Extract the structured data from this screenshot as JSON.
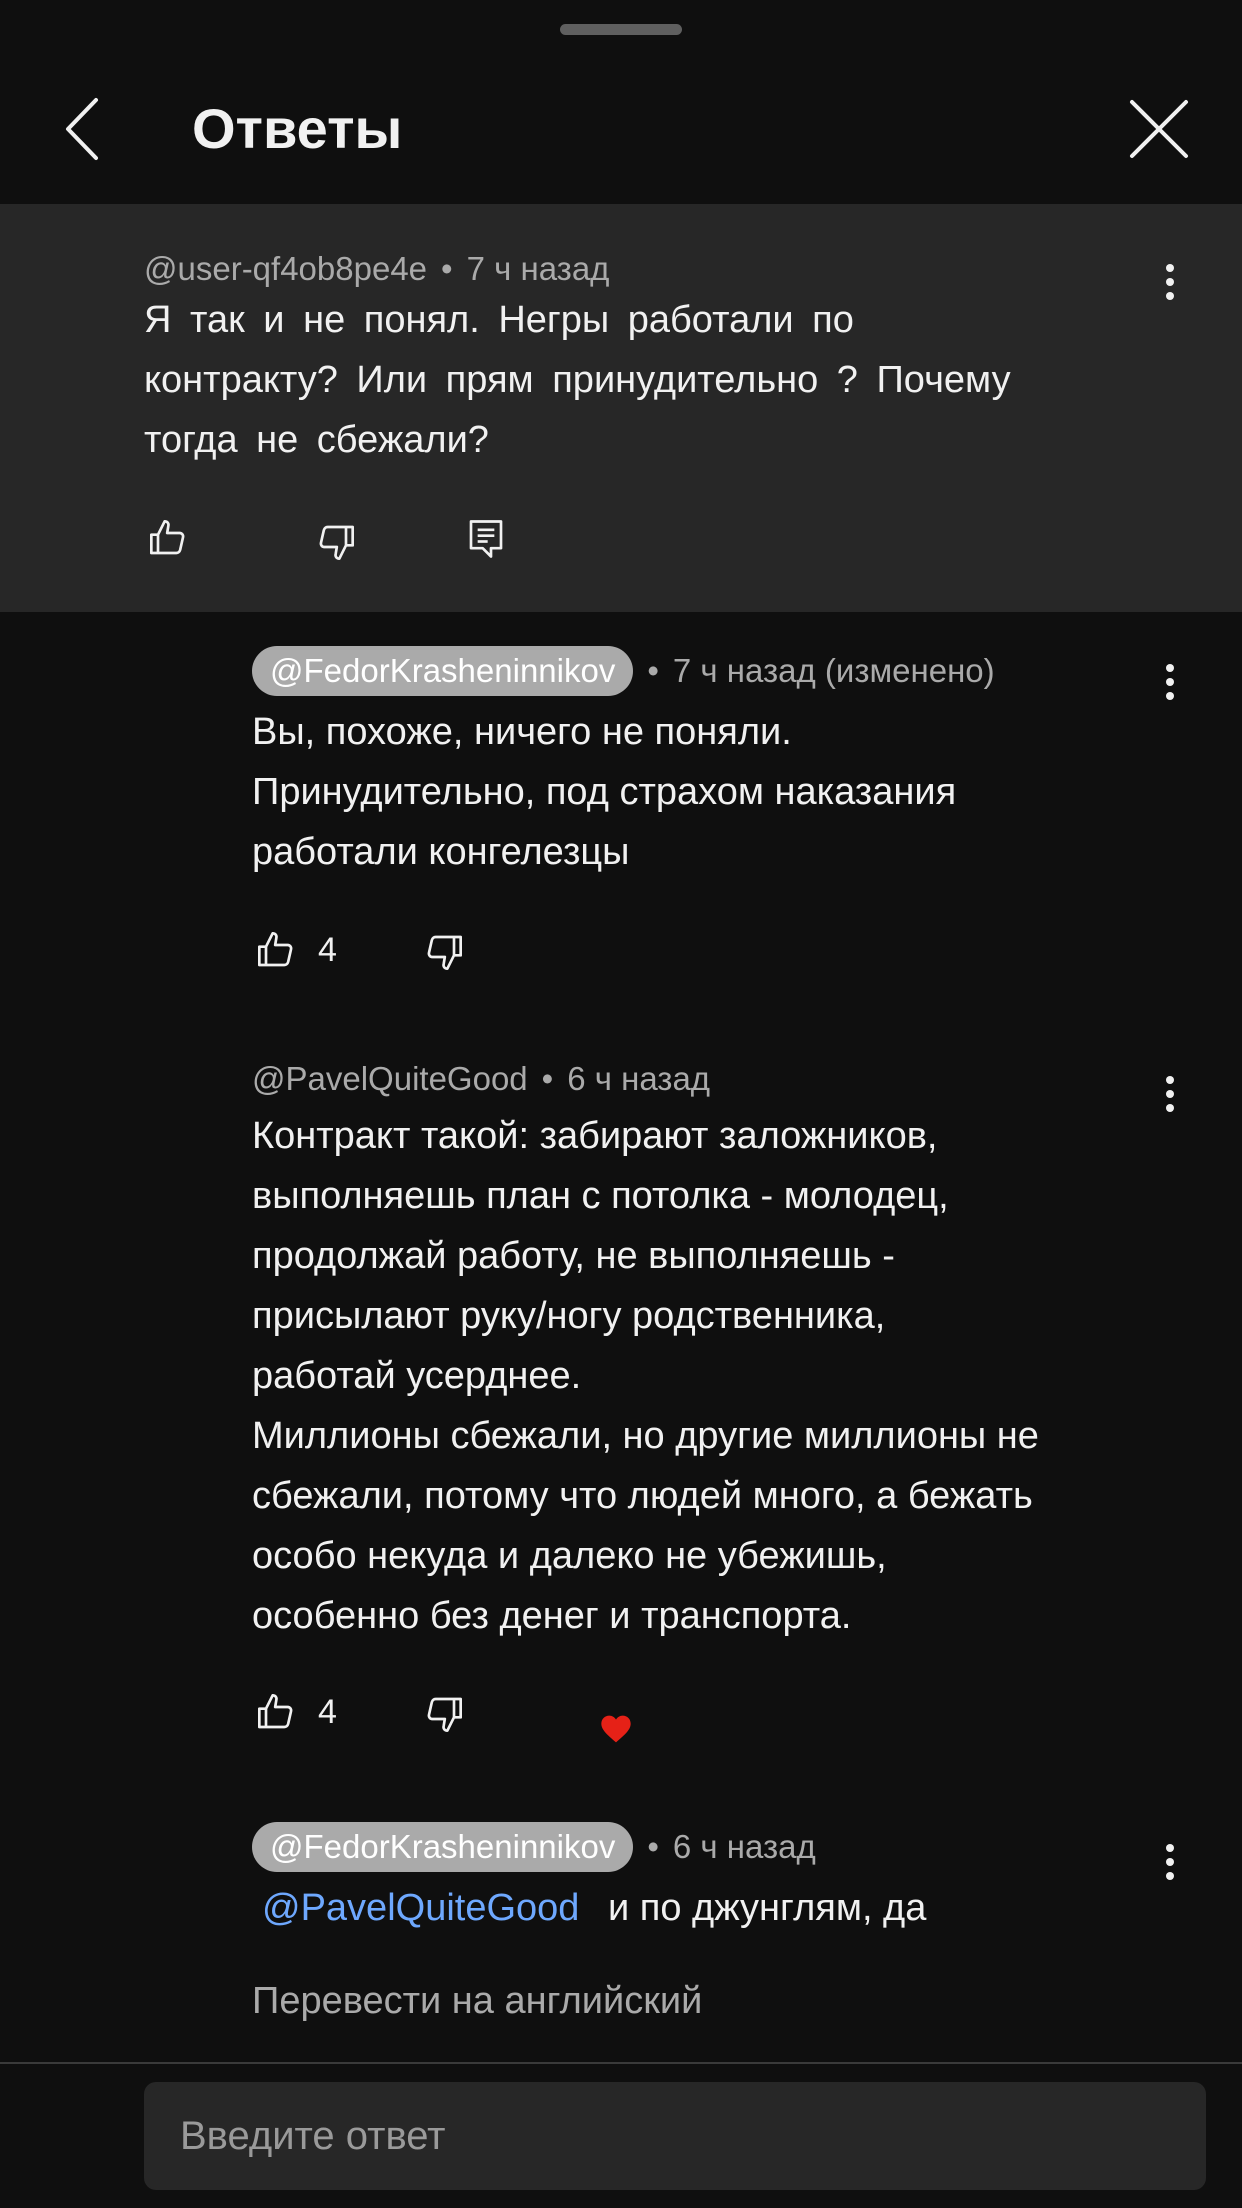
{
  "header": {
    "title": "Ответы"
  },
  "parent_comment": {
    "author": "@user-qf4ob8pe4e",
    "time": "7 ч назад",
    "lines": [
      "Я так и не понял. Негры работали по",
      "контракту?  Или прям принудительно  ? Почему",
      "тогда  не  сбежали?"
    ]
  },
  "replies": [
    {
      "author": "@FedorKrasheninnikov",
      "time": "7 ч назад (изменено)",
      "lines": [
        "Вы, похоже, ничего не поняли.",
        "Принудительно, под страхом наказания",
        "работали конгелезцы"
      ],
      "likes": "4"
    },
    {
      "author": "@PavelQuiteGood",
      "time": "6 ч назад",
      "lines": [
        "Контракт такой: забирают заложников,",
        "выполняешь план с потолка - молодец,",
        "продолжай работу, не выполняешь -",
        "присылают руку/ногу родственника,",
        "работай усерднее.",
        "Миллионы сбежали, но другие миллионы не",
        "сбежали, потому что людей много, а бежать",
        "особо некуда и далеко не убежишь,",
        "особенно без денег и транспорта."
      ],
      "likes": "4",
      "hearted": true
    },
    {
      "author": "@FedorKrasheninnikov",
      "time": "6 ч назад",
      "mention": "@PavelQuiteGood",
      "text": "и по джунглям, да"
    }
  ],
  "translate_label": "Перевести на английский",
  "reply_input": {
    "placeholder": "Введите ответ"
  },
  "colors": {
    "background": "#0f0f0f",
    "parent_background": "#272727",
    "mention": "#6ea8fe",
    "heart": "#e62117",
    "pill": "#aaaaaa"
  }
}
